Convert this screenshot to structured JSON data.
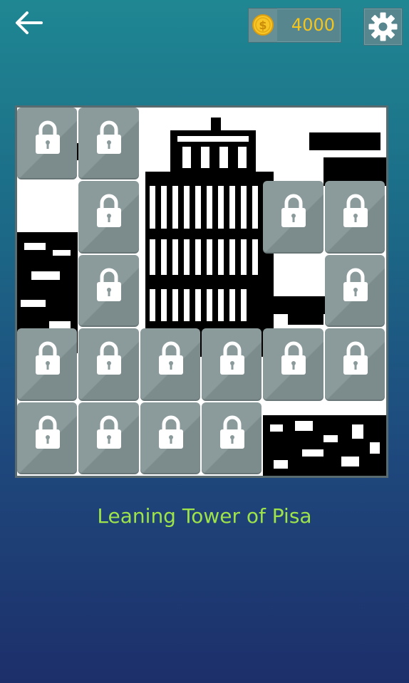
{
  "header": {
    "back_icon": "back-arrow-icon",
    "coin_icon": "coin-icon",
    "coins": "4000",
    "settings_icon": "gear-icon"
  },
  "puzzle": {
    "rows": 5,
    "cols": 6,
    "locked_tiles": [
      [
        0,
        0
      ],
      [
        0,
        1
      ],
      [
        1,
        1
      ],
      [
        1,
        4
      ],
      [
        1,
        5
      ],
      [
        2,
        1
      ],
      [
        2,
        5
      ],
      [
        3,
        0
      ],
      [
        3,
        1
      ],
      [
        3,
        2
      ],
      [
        3,
        3
      ],
      [
        3,
        4
      ],
      [
        3,
        5
      ],
      [
        4,
        0
      ],
      [
        4,
        1
      ],
      [
        4,
        2
      ],
      [
        4,
        3
      ]
    ],
    "lock_icon": "padlock-icon",
    "image_subject": "Leaning Tower of Pisa pixel art"
  },
  "title": "Leaning Tower of Pisa",
  "colors": {
    "coins": "#f5c51c",
    "title": "#9ee34a",
    "tile": "#8b9a9b"
  }
}
